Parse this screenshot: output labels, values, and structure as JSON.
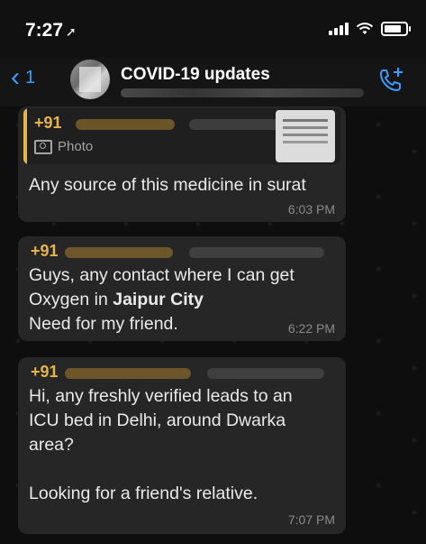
{
  "status_bar": {
    "time": "7:27",
    "location_glyph": "➚",
    "icons": [
      "signal-icon",
      "wifi-icon",
      "battery-icon"
    ]
  },
  "header": {
    "back_count": "1",
    "title": "COVID-19 updates",
    "call_icon": "add-call-icon"
  },
  "messages": [
    {
      "sender": "+91",
      "quote": {
        "sender": "+91",
        "type": "Photo"
      },
      "text": "Any source of this medicine in surat",
      "time": "6:03 PM"
    },
    {
      "sender": "+91",
      "text_before": "Guys, any contact where I can get\nOxygen in ",
      "text_bold": "Jaipur City",
      "text_after": "\nNeed for my friend.",
      "time": "6:22 PM"
    },
    {
      "sender": "+91",
      "text": "Hi, any freshly verified leads to an\nICU bed in Delhi, around Dwarka\narea?\n\nLooking for a friend's relative.",
      "time": "7:07 PM"
    }
  ],
  "colors": {
    "accent_blue": "#3a9eff",
    "sender_gold": "#e6b447",
    "bubble": "#262626"
  }
}
